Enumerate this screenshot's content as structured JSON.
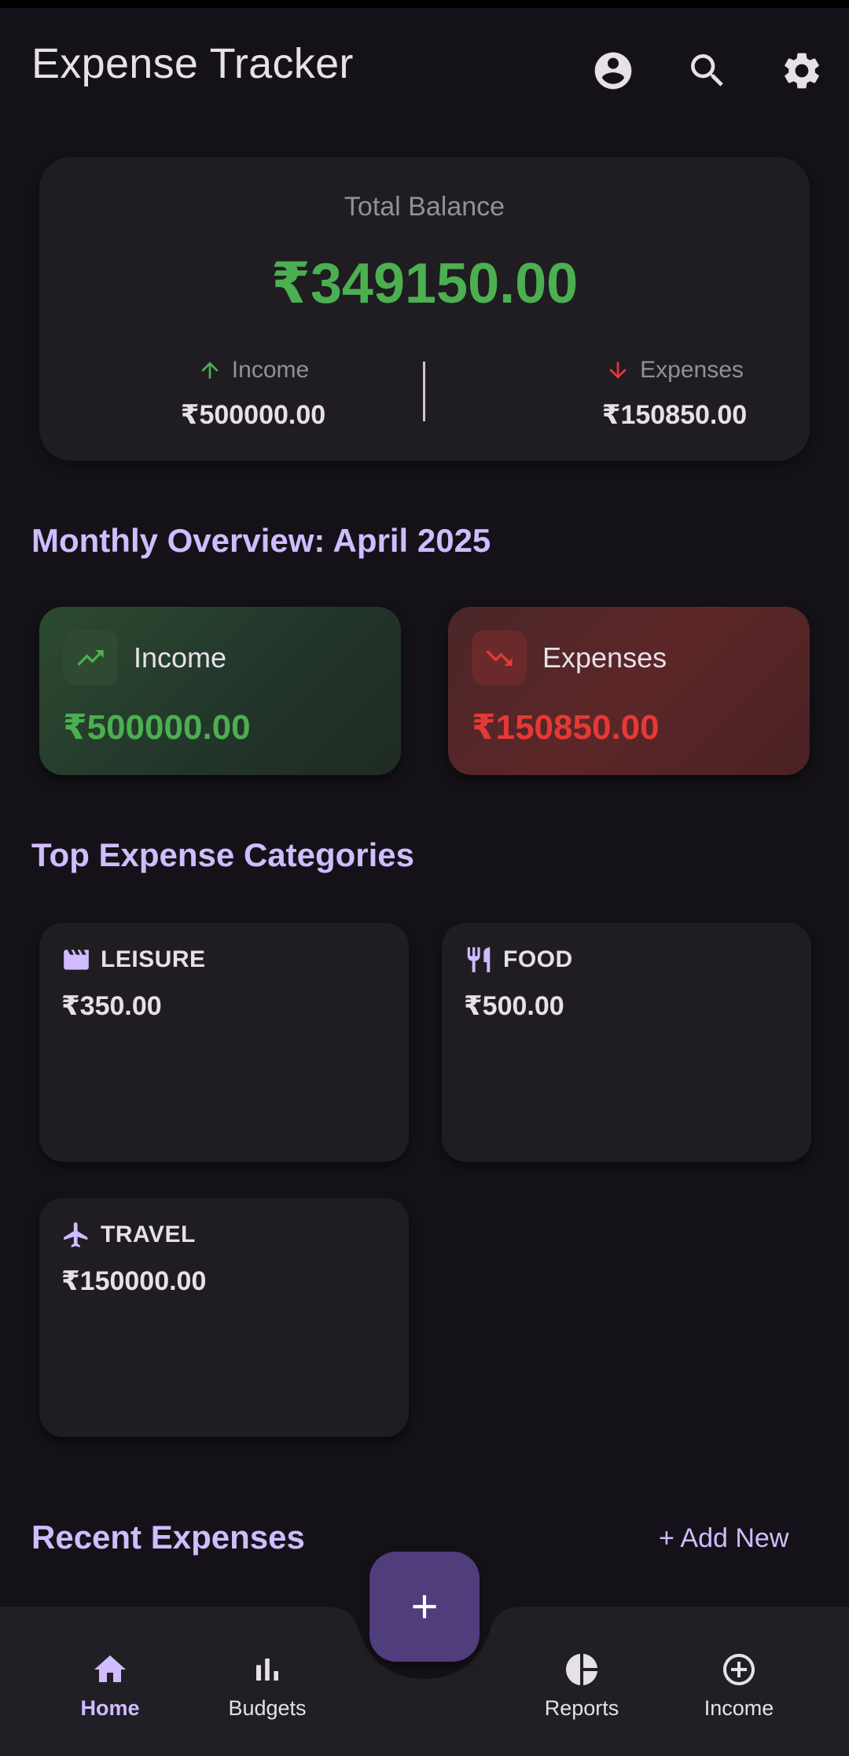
{
  "app": {
    "title": "Expense Tracker",
    "colors": {
      "accent": "#d0bcff",
      "income": "#4caf50",
      "expense": "#e53935",
      "background": "#141218"
    }
  },
  "header": {
    "icons": [
      "account-circle-icon",
      "search-icon",
      "settings-icon"
    ]
  },
  "balance": {
    "label": "Total Balance",
    "amount": "₹349150.00",
    "income_label": "Income",
    "income_value": "₹500000.00",
    "expenses_label": "Expenses",
    "expenses_value": "₹150850.00"
  },
  "overview": {
    "title": "Monthly Overview: April 2025",
    "income": {
      "label": "Income",
      "value": "₹500000.00",
      "icon": "trending-up-icon"
    },
    "expenses": {
      "label": "Expenses",
      "value": "₹150850.00",
      "icon": "trending-down-icon"
    }
  },
  "categories": {
    "title": "Top Expense Categories",
    "items": [
      {
        "name": "LEISURE",
        "amount": "₹350.00",
        "icon": "movie-icon"
      },
      {
        "name": "FOOD",
        "amount": "₹500.00",
        "icon": "restaurant-icon"
      },
      {
        "name": "TRAVEL",
        "amount": "₹150000.00",
        "icon": "flight-icon"
      }
    ]
  },
  "recent": {
    "title": "Recent Expenses",
    "add_new": "+ Add New"
  },
  "nav": {
    "items": [
      {
        "label": "Home",
        "icon": "home-icon",
        "active": true
      },
      {
        "label": "Budgets",
        "icon": "bar-chart-icon",
        "active": false
      },
      {
        "label": "Reports",
        "icon": "pie-chart-icon",
        "active": false
      },
      {
        "label": "Income",
        "icon": "add-circle-icon",
        "active": false
      }
    ],
    "fab_icon": "plus-icon"
  }
}
